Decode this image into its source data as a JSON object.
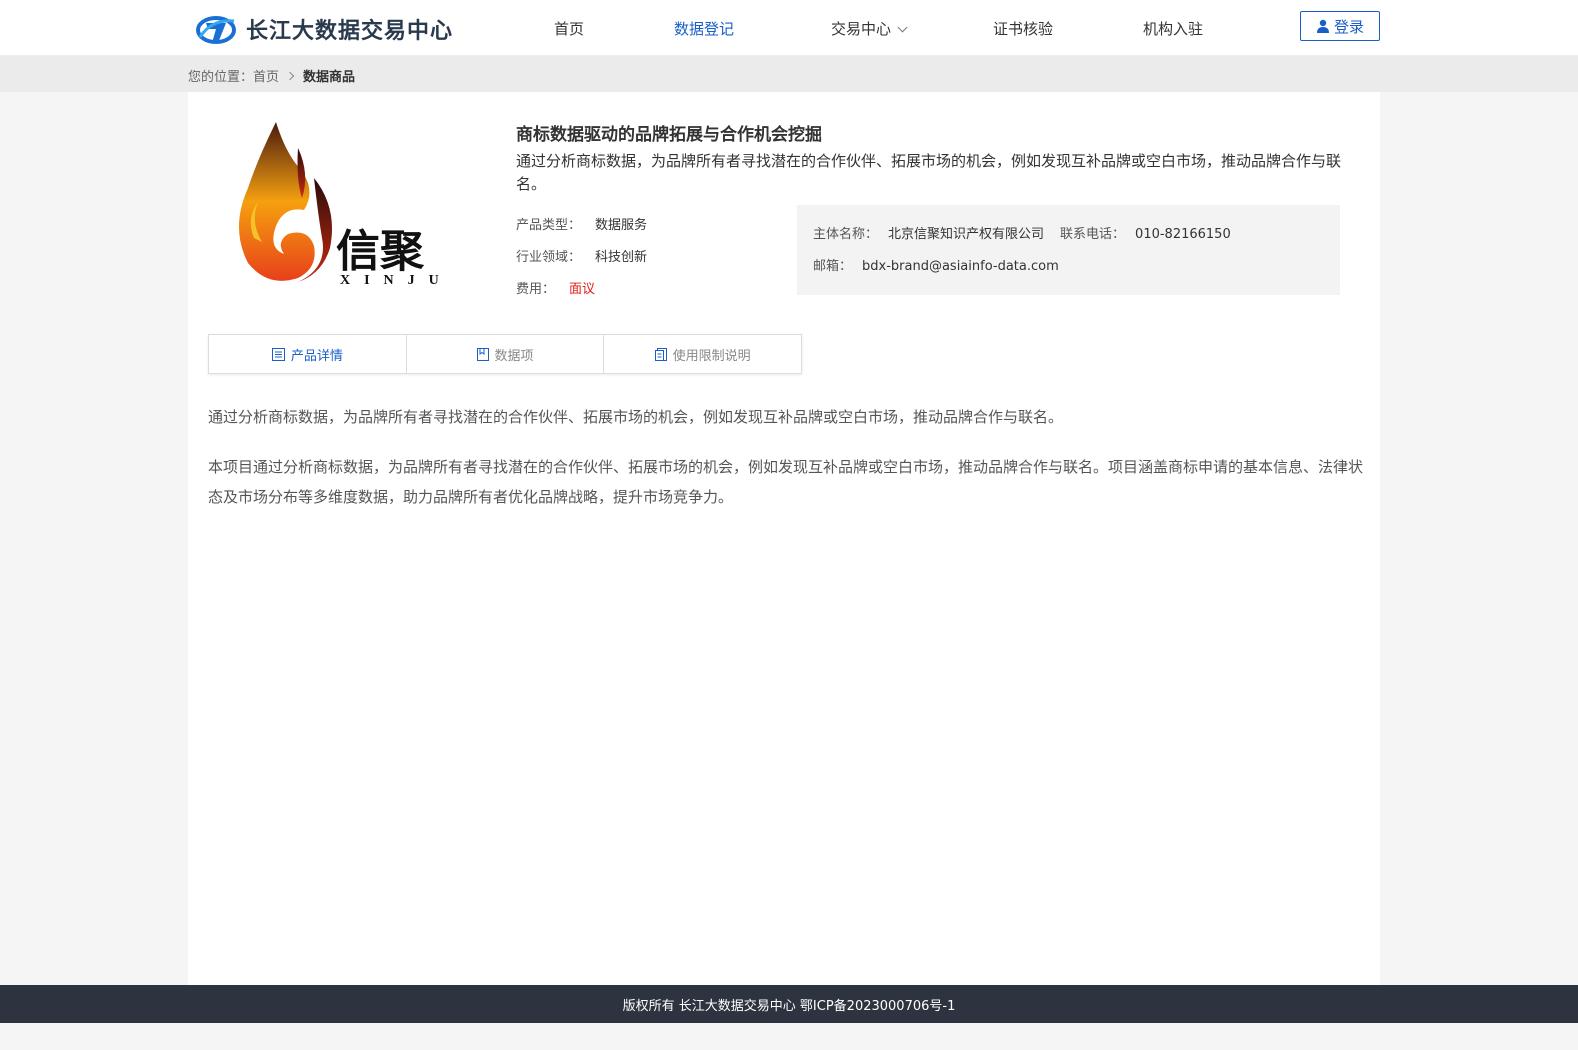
{
  "header": {
    "brand_name": "长江大数据交易中心",
    "nav": [
      "首页",
      "数据登记",
      "交易中心",
      "证书核验",
      "机构入驻"
    ],
    "login_label": "登录"
  },
  "breadcrumb": {
    "prefix": "您的位置：",
    "home": "首页",
    "current": "数据商品"
  },
  "product": {
    "logo_text": "信聚",
    "logo_sub": "XINJU",
    "title": "商标数据驱动的品牌拓展与合作机会挖掘",
    "summary": "通过分析商标数据，为品牌所有者寻找潜在的合作伙伴、拓展市场的机会，例如发现互补品牌或空白市场，推动品牌合作与联名。",
    "type_label": "产品类型：",
    "type_value": "数据服务",
    "industry_label": "行业领域：",
    "industry_value": "科技创新",
    "fee_label": "费用：",
    "fee_value": "面议"
  },
  "contact": {
    "subject_label": "主体名称：",
    "subject_value": "北京信聚知识产权有限公司",
    "phone_label": "联系电话：",
    "phone_value": "010-82166150",
    "email_label": "邮箱：",
    "email_value": "bdx-brand@asiainfo-data.com"
  },
  "tabs": [
    "产品详情",
    "数据项",
    "使用限制说明"
  ],
  "detail": {
    "para1": "通过分析商标数据，为品牌所有者寻找潜在的合作伙伴、拓展市场的机会，例如发现互补品牌或空白市场，推动品牌合作与联名。",
    "para2": "本项目通过分析商标数据，为品牌所有者寻找潜在的合作伙伴、拓展市场的机会，例如发现互补品牌或空白市场，推动品牌合作与联名。项目涵盖商标申请的基本信息、法律状态及市场分布等多维度数据，助力品牌所有者优化品牌战略，提升市场竞争力。"
  },
  "footer": {
    "text": "版权所有 长江大数据交易中心 鄂ICP备2023000706号-1"
  },
  "colors": {
    "accent": "#1a5fc9",
    "fee": "#e0201a",
    "footer_bg": "#2e3340"
  }
}
